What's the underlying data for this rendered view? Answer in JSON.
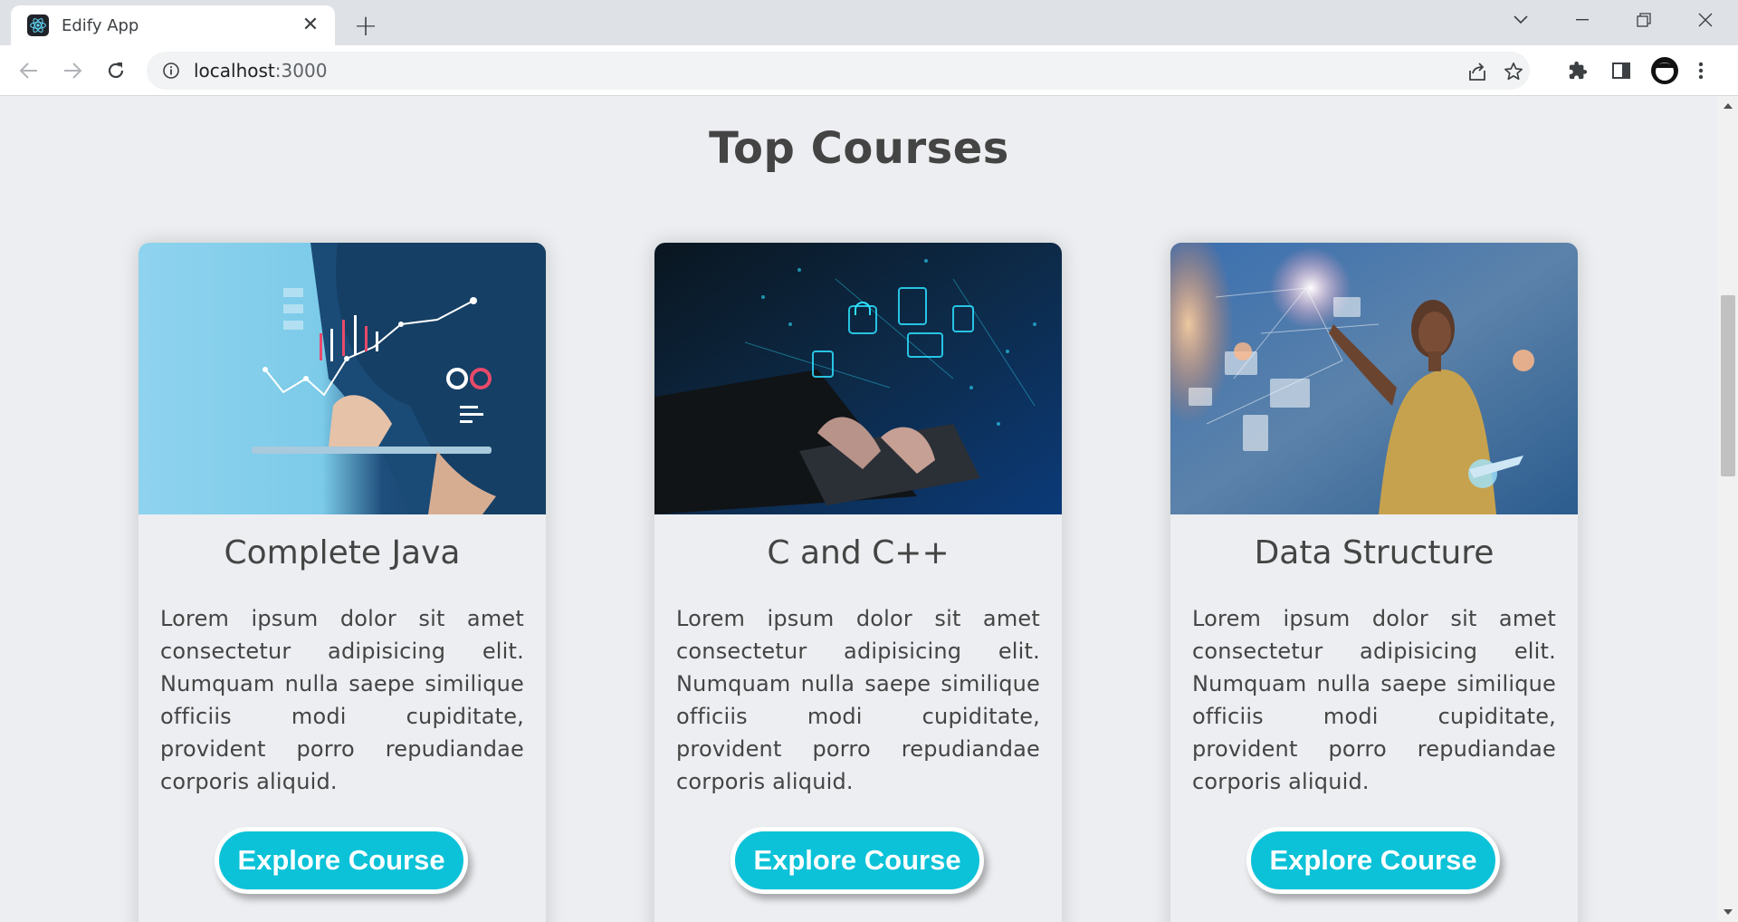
{
  "browser": {
    "tab_title": "Edify App",
    "tab_close": "✕",
    "new_tab": "+",
    "url_host": "localhost",
    "url_port": ":3000"
  },
  "page": {
    "title": "Top Courses"
  },
  "courses": [
    {
      "title": "Complete Java",
      "description": "Lorem ipsum dolor sit amet consectetur adipisicing elit. Numquam nulla saepe similique officiis modi cupiditate, provident porro repudiandae corporis aliquid.",
      "button_label": "Explore Course"
    },
    {
      "title": "C and C++",
      "description": "Lorem ipsum dolor sit amet consectetur adipisicing elit. Numquam nulla saepe similique officiis modi cupiditate, provident porro repudiandae corporis aliquid.",
      "button_label": "Explore Course"
    },
    {
      "title": "Data Structure",
      "description": "Lorem ipsum dolor sit amet consectetur adipisicing elit. Numquam nulla saepe similique officiis modi cupiditate, provident porro repudiandae corporis aliquid.",
      "button_label": "Explore Course"
    }
  ],
  "colors": {
    "accent": "#0cc2d8",
    "page_bg": "#eceef1",
    "text": "#444444"
  },
  "icons": [
    "react-favicon-icon",
    "close-icon",
    "plus-icon",
    "chevron-down-icon",
    "minimize-icon",
    "restore-icon",
    "window-close-icon",
    "back-icon",
    "forward-icon",
    "reload-icon",
    "info-icon",
    "share-icon",
    "star-icon",
    "extensions-icon",
    "side-panel-icon",
    "profile-icon",
    "menu-icon"
  ]
}
